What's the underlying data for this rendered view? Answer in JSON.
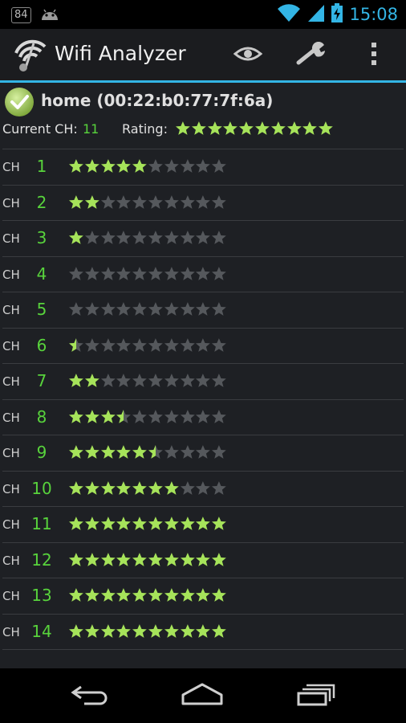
{
  "status_bar": {
    "notification_badge": "84",
    "time": "15:08",
    "icons": [
      "screenshot-badge-icon",
      "android-icon",
      "wifi-signal-icon",
      "cell-signal-icon",
      "battery-charging-icon"
    ]
  },
  "action_bar": {
    "title": "Wifi Analyzer",
    "icons": [
      "wifi-analyzer-logo-icon",
      "eye-icon",
      "wrench-icon",
      "overflow-menu-icon"
    ]
  },
  "ap": {
    "name": "home (00:22:b0:77:7f:6a)",
    "current_ch_label": "Current CH:",
    "current_ch_value": "11",
    "rating_label": "Rating:",
    "rating_stars": 10
  },
  "channels": [
    {
      "label": "CH",
      "number": "1",
      "stars": 5
    },
    {
      "label": "CH",
      "number": "2",
      "stars": 2
    },
    {
      "label": "CH",
      "number": "3",
      "stars": 1
    },
    {
      "label": "CH",
      "number": "4",
      "stars": 0
    },
    {
      "label": "CH",
      "number": "5",
      "stars": 0
    },
    {
      "label": "CH",
      "number": "6",
      "stars": 0.5
    },
    {
      "label": "CH",
      "number": "7",
      "stars": 2
    },
    {
      "label": "CH",
      "number": "8",
      "stars": 3.5
    },
    {
      "label": "CH",
      "number": "9",
      "stars": 5.5
    },
    {
      "label": "CH",
      "number": "10",
      "stars": 7
    },
    {
      "label": "CH",
      "number": "11",
      "stars": 10
    },
    {
      "label": "CH",
      "number": "12",
      "stars": 10
    },
    {
      "label": "CH",
      "number": "13",
      "stars": 10
    },
    {
      "label": "CH",
      "number": "14",
      "stars": 10
    }
  ],
  "max_stars": 10,
  "colors": {
    "accent": "#33b5e5",
    "channel_green": "#58d33c",
    "star_on": "#a6e35a",
    "star_off": "#55585c"
  },
  "nav_bar": {
    "icons": [
      "back-icon",
      "home-icon",
      "recent-apps-icon"
    ]
  }
}
